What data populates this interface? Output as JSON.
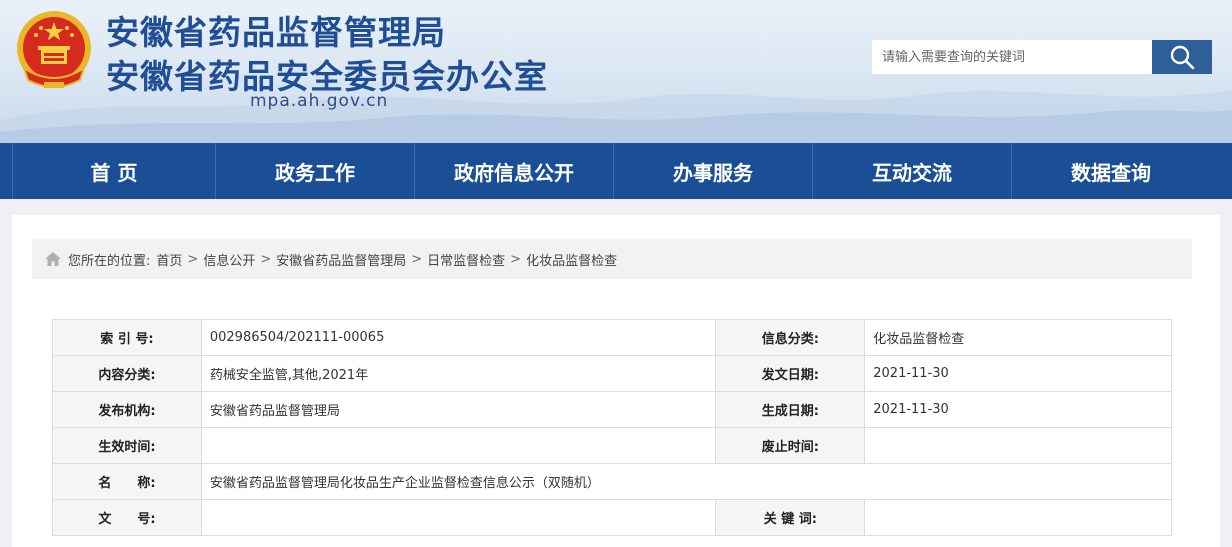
{
  "header": {
    "title_line1": "安徽省药品监督管理局",
    "title_line2": "安徽省药品安全委员会办公室",
    "domain": "mpa.ah.gov.cn",
    "emblem_icon": "national-emblem-icon"
  },
  "search": {
    "placeholder": "请输入需要查询的关键词",
    "button_icon": "search-icon"
  },
  "nav": {
    "items": [
      "首 页",
      "政务工作",
      "政府信息公开",
      "办事服务",
      "互动交流",
      "数据查询"
    ]
  },
  "breadcrumb": {
    "prefix": "您所在的位置:",
    "items": [
      "首页",
      "信息公开",
      "安徽省药品监督管理局",
      "日常监督检查",
      "化妆品监督检查"
    ],
    "separator": ">"
  },
  "meta": {
    "index_label": "索 引 号:",
    "index_value": "002986504/202111-00065",
    "info_category_label": "信息分类:",
    "info_category_value": "化妆品监督检查",
    "content_category_label": "内容分类:",
    "content_category_value": "药械安全监管,其他,2021年",
    "issue_date_label": "发文日期:",
    "issue_date_value": "2021-11-30",
    "publisher_label": "发布机构:",
    "publisher_value": "安徽省药品监督管理局",
    "created_date_label": "生成日期:",
    "created_date_value": "2021-11-30",
    "effective_label": "生效时间:",
    "effective_value": "",
    "abolish_label": "废止时间:",
    "abolish_value": "",
    "name_label": "名　　称:",
    "name_value": "安徽省药品监督管理局化妆品生产企业监督检查信息公示（双随机）",
    "doc_no_label": "文　　号:",
    "doc_no_value": "",
    "keywords_label": "关 键 词:",
    "keywords_value": ""
  },
  "colors": {
    "brand_blue": "#1b4f95",
    "title_blue": "#1f4e97",
    "search_button": "#2f5f99"
  }
}
